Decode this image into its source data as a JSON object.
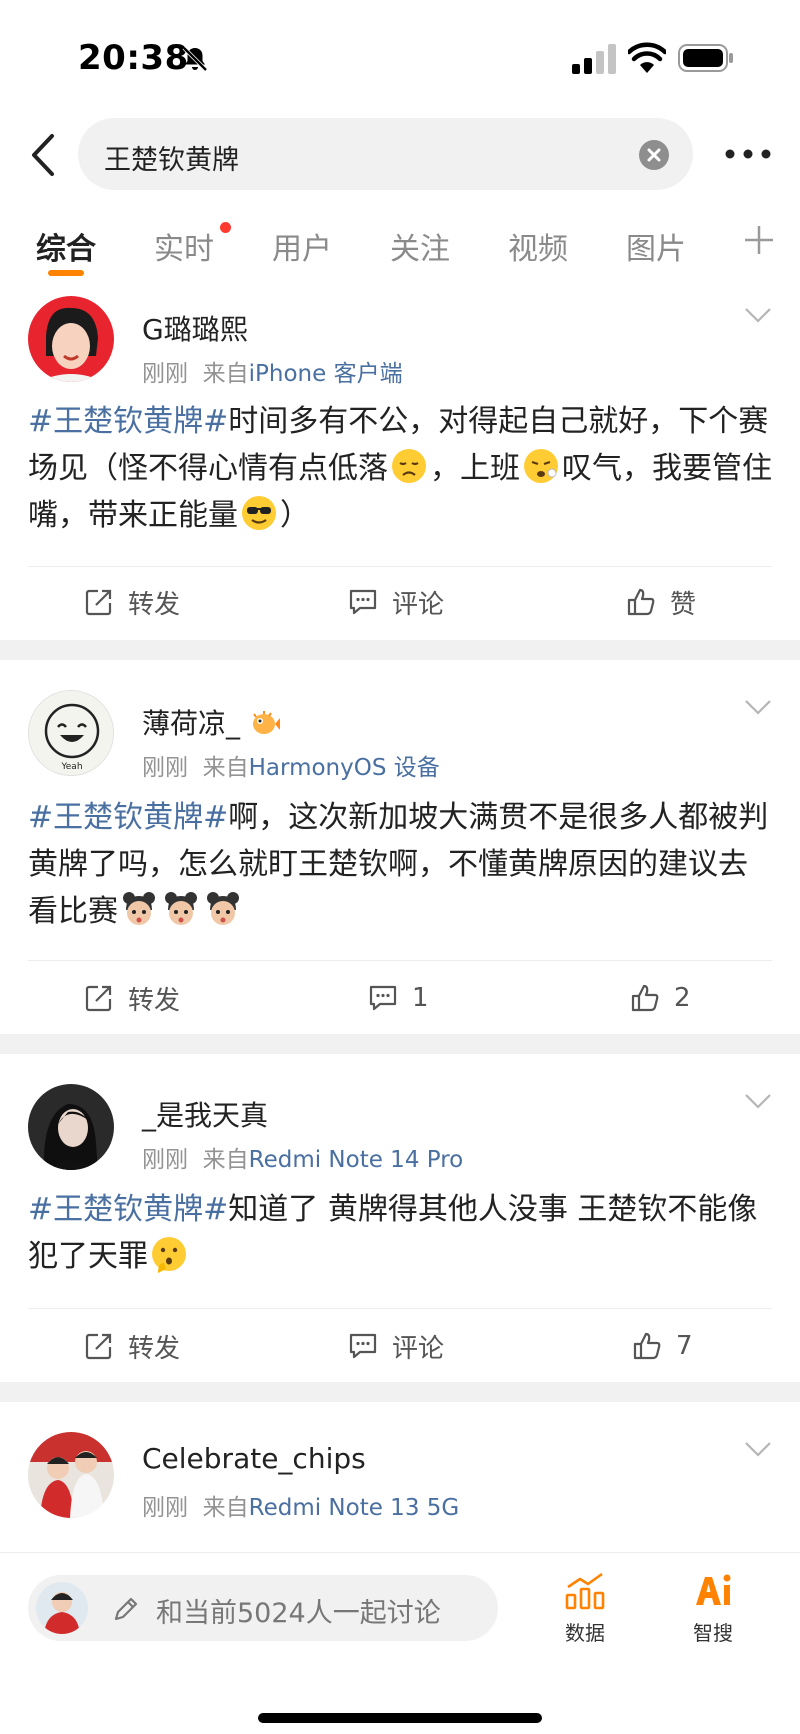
{
  "status_bar": {
    "time": "20:38"
  },
  "search": {
    "query": "王楚钦黄牌"
  },
  "tabs": [
    {
      "label": "综合"
    },
    {
      "label": "实时"
    },
    {
      "label": "用户"
    },
    {
      "label": "关注"
    },
    {
      "label": "视频"
    },
    {
      "label": "图片"
    }
  ],
  "posts": [
    {
      "username": "G璐璐熙",
      "time": "刚刚",
      "from_label": "来自",
      "source": "iPhone 客户端",
      "tag": "#王楚钦黄牌#",
      "text_1": "时间多有不公，对得起自己就好，下个赛场见（怪不得心情有点低落",
      "text_2": "，上班",
      "text_3": "叹气，我要管住嘴，带来正能量",
      "text_4": "）",
      "repost": "转发",
      "comment": "评论",
      "like": "赞"
    },
    {
      "username": "薄荷凉_",
      "time": "刚刚",
      "from_label": "来自",
      "source": "HarmonyOS 设备",
      "tag": "#王楚钦黄牌#",
      "text_1": "啊，这次新加坡大满贯不是很多人都被判黄牌了吗，怎么就盯王楚钦啊，不懂黄牌原因的建议去看比赛",
      "repost": "转发",
      "comment": "1",
      "like": "2"
    },
    {
      "username": "_是我天真",
      "time": "刚刚",
      "from_label": "来自",
      "source": "Redmi Note 14 Pro",
      "tag": "#王楚钦黄牌#",
      "text_1": "知道了 黄牌得其他人没事 王楚钦不能像犯了天罪",
      "repost": "转发",
      "comment": "评论",
      "like": "7"
    },
    {
      "username": "Celebrate_chips",
      "time": "刚刚",
      "from_label": "来自",
      "source": "Redmi Note 13 5G"
    }
  ],
  "bottom_bar": {
    "discuss_placeholder": "和当前5024人一起讨论",
    "data_label": "数据",
    "ai_label": "智搜"
  },
  "colors": {
    "accent": "#ff8200",
    "link": "#4a6fa1",
    "dot": "#ff3b30"
  }
}
